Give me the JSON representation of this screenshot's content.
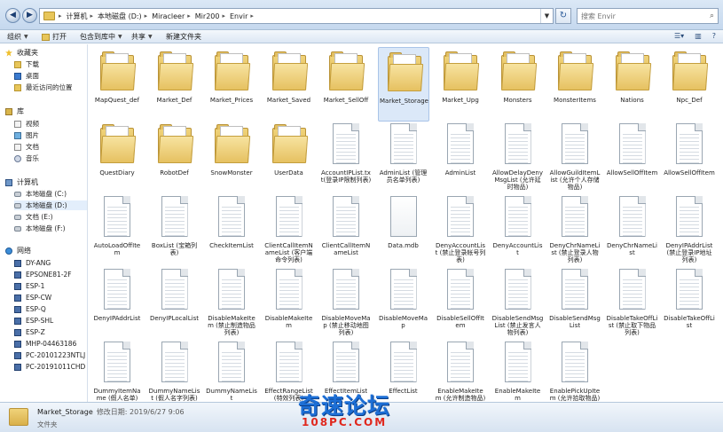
{
  "address": {
    "crumbs": [
      "计算机",
      "本地磁盘 (D:)",
      "Miracleer",
      "Mir200",
      "Envir"
    ],
    "search_placeholder": "搜索 Envir"
  },
  "command_bar": {
    "organize": "组织",
    "open": "打开",
    "include_in_library": "包含到库中",
    "share": "共享",
    "new_folder": "新建文件夹"
  },
  "nav": {
    "favorites_header": "收藏夹",
    "favorites": [
      "下载",
      "桌面",
      "最近访问的位置"
    ],
    "libraries_header": "库",
    "libraries": [
      "视频",
      "图片",
      "文档",
      "音乐"
    ],
    "computer_header": "计算机",
    "drives": [
      "本地磁盘 (C:)",
      "本地磁盘 (D:)",
      "文档 (E:)",
      "本地磁盘 (F:)"
    ],
    "network_header": "网络",
    "network": [
      "DY-ANG",
      "EPSONE81-2F",
      "ESP-1",
      "ESP-CW",
      "ESP-Q",
      "ESP-SHL",
      "ESP-Z",
      "MHP-04463186",
      "PC-20101223NTLJ",
      "PC-20191011CHD"
    ]
  },
  "files": [
    {
      "name": "MapQuest_def",
      "type": "folder"
    },
    {
      "name": "Market_Def",
      "type": "folder"
    },
    {
      "name": "Market_Prices",
      "type": "folder"
    },
    {
      "name": "Market_Saved",
      "type": "folder"
    },
    {
      "name": "Market_SellOff",
      "type": "folder"
    },
    {
      "name": "Market_Storage",
      "type": "folder",
      "selected": true
    },
    {
      "name": "Market_Upg",
      "type": "folder"
    },
    {
      "name": "Monsters",
      "type": "folder"
    },
    {
      "name": "MonsterItems",
      "type": "folder"
    },
    {
      "name": "Nations",
      "type": "folder"
    },
    {
      "name": "Npc_Def",
      "type": "folder"
    },
    {
      "name": "QuestDiary",
      "type": "folder"
    },
    {
      "name": "RobotDef",
      "type": "folder"
    },
    {
      "name": "SnowMonster",
      "type": "folder"
    },
    {
      "name": "UserData",
      "type": "folder"
    },
    {
      "name": "AccountIPList.txt(登录IP限制列表)",
      "type": "file"
    },
    {
      "name": "AdminList (管理员名单列表)",
      "type": "file"
    },
    {
      "name": "AdminList",
      "type": "file"
    },
    {
      "name": "AllowDelayDenyMsgList (允许延时物品)",
      "type": "file"
    },
    {
      "name": "AllowGuildItemList (允许个人存储物品)",
      "type": "file"
    },
    {
      "name": "AllowSellOffItem",
      "type": "file"
    },
    {
      "name": "AllowSellOffItem",
      "type": "file"
    },
    {
      "name": "AutoLoadOffItem",
      "type": "file"
    },
    {
      "name": "BoxList (宝箱列表)",
      "type": "file"
    },
    {
      "name": "CheckItemList",
      "type": "file"
    },
    {
      "name": "ClientCallItemNameList (客户端命令列表)",
      "type": "file"
    },
    {
      "name": "ClientCallItemNameList",
      "type": "file"
    },
    {
      "name": "Data.mdb",
      "type": "mdb"
    },
    {
      "name": "DenyAccountList (禁止登录帐号列表)",
      "type": "file"
    },
    {
      "name": "DenyAccountList",
      "type": "file"
    },
    {
      "name": "DenyChrNameList (禁止登录人物列表)",
      "type": "file"
    },
    {
      "name": "DenyChrNameList",
      "type": "file"
    },
    {
      "name": "DenyIPAddrList (禁止登录IP地址列表)",
      "type": "file"
    },
    {
      "name": "DenyIPAddrList",
      "type": "file"
    },
    {
      "name": "DenyIPLocalList",
      "type": "file"
    },
    {
      "name": "DisableMakeItem (禁止制造物品列表)",
      "type": "file"
    },
    {
      "name": "DisableMakeItem",
      "type": "file"
    },
    {
      "name": "DisableMoveMap (禁止移动地图列表)",
      "type": "file"
    },
    {
      "name": "DisableMoveMap",
      "type": "file"
    },
    {
      "name": "DisableSellOffItem",
      "type": "file"
    },
    {
      "name": "DisableSendMsgList (禁止发言人物列表)",
      "type": "file"
    },
    {
      "name": "DisableSendMsgList",
      "type": "file"
    },
    {
      "name": "DisableTakeOffList (禁止取下物品列表)",
      "type": "file"
    },
    {
      "name": "DisableTakeOffList",
      "type": "file"
    },
    {
      "name": "DummyItemName (假人名单)",
      "type": "file"
    },
    {
      "name": "DummyNameList (假人名字列表)",
      "type": "file"
    },
    {
      "name": "DummyNameList",
      "type": "file"
    },
    {
      "name": "EffectRangeList (特效列表)",
      "type": "file"
    },
    {
      "name": "EffectItemList",
      "type": "file"
    },
    {
      "name": "EffectList",
      "type": "file"
    },
    {
      "name": "EnableMakeItem (允许制造物品)",
      "type": "file"
    },
    {
      "name": "EnableMakeItem",
      "type": "file"
    },
    {
      "name": "EnablePickUpItem (允许拾取物品)",
      "type": "file"
    }
  ],
  "details": {
    "name": "Market_Storage",
    "meta": "修改日期: 2019/6/27 9:06",
    "kind": "文件夹"
  },
  "watermark": {
    "cn": "奇速论坛",
    "en": "108PC.COM"
  }
}
